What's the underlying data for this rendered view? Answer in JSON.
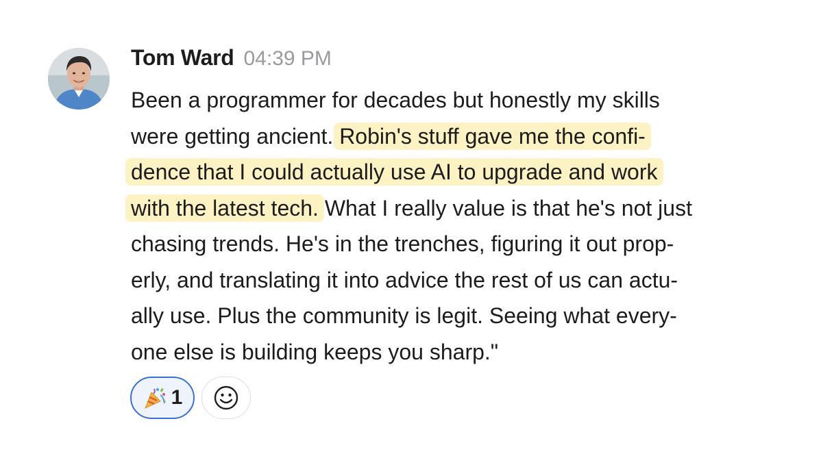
{
  "message": {
    "author": "Tom Ward",
    "timestamp": "04:39 PM",
    "avatar_icon": "user-avatar-photo",
    "lines": [
      {
        "before": "Been a programmer for decades but honestly my skills",
        "highlight": "",
        "after": ""
      },
      {
        "before": "were getting ancient. ",
        "highlight": "Robin's stuff gave me the confi-",
        "after": ""
      },
      {
        "before": "",
        "highlight": "dence that I could actually use AI to upgrade and work",
        "after": ""
      },
      {
        "before": "",
        "highlight": "with the latest tech.",
        "after": " What I really value is that he's not just"
      },
      {
        "before": "chasing trends. He's in the trenches, figuring it out prop-",
        "highlight": "",
        "after": ""
      },
      {
        "before": "erly, and translating it into advice the rest of us can actu-",
        "highlight": "",
        "after": ""
      },
      {
        "before": "ally use. Plus the community is legit. Seeing what every-",
        "highlight": "",
        "after": ""
      },
      {
        "before": "one else is building keeps you sharp.\"",
        "highlight": "",
        "after": ""
      }
    ],
    "highlight_color": "#fcf2c4"
  },
  "reactions": [
    {
      "emoji_icon": "party-popper-icon",
      "count": "1",
      "selected": true
    },
    {
      "emoji_icon": "add-reaction-smiley-icon",
      "count": "",
      "selected": false
    }
  ],
  "colors": {
    "text": "#1d1c1d",
    "timestamp": "#9a9a9e",
    "reaction_selected_border": "#3d6fd3",
    "reaction_selected_bg": "#eef3fc"
  }
}
